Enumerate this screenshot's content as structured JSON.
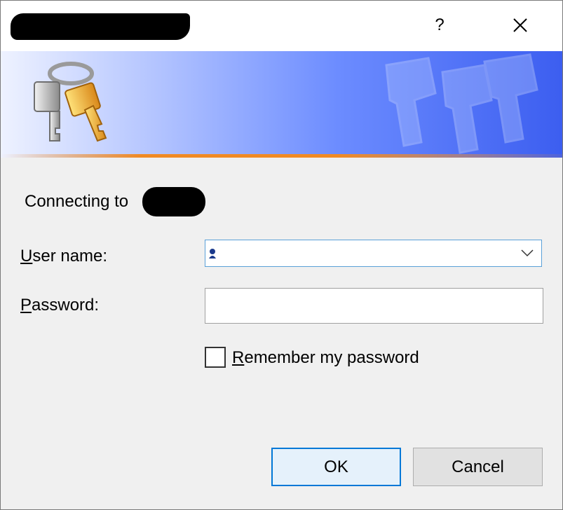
{
  "dialog": {
    "help_label": "?",
    "close_icon": "close-icon"
  },
  "banner": {
    "icon": "keys-icon",
    "colors": {
      "gradient_start": "#eef2ff",
      "gradient_end": "#3c5ef0",
      "accent": "#f08a24"
    }
  },
  "form": {
    "connecting_label": "Connecting to",
    "username_label_underlined": "U",
    "username_label_rest": "ser name:",
    "username_value": "",
    "password_label_underlined": "P",
    "password_label_rest": "assword:",
    "password_value": "",
    "remember_label_underlined": "R",
    "remember_label_rest": "emember my password",
    "remember_checked": false
  },
  "buttons": {
    "ok_label": "OK",
    "cancel_label": "Cancel"
  }
}
